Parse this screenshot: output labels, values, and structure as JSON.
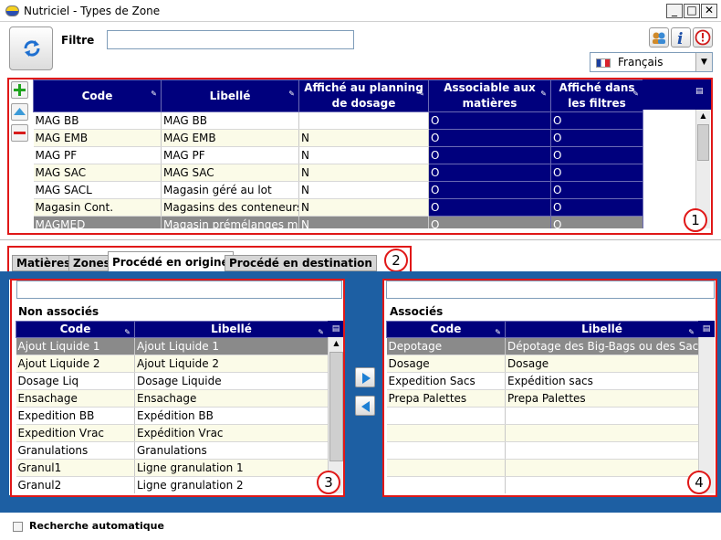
{
  "window": {
    "title": "Nutriciel - Types de Zone",
    "minimize": "_",
    "maximize": "□",
    "close": "✕"
  },
  "filter": {
    "label": "Filtre",
    "value": ""
  },
  "language": {
    "selected": "Français"
  },
  "top_grid": {
    "columns": [
      "Code",
      "Libellé",
      "Affiché au planning de dosage",
      "Associable aux matières",
      "Affiché dans les filtres"
    ],
    "rows": [
      [
        "MAG BB",
        "MAG BB",
        "",
        "O",
        "O"
      ],
      [
        "MAG EMB",
        "MAG EMB",
        "N",
        "O",
        "O"
      ],
      [
        "MAG PF",
        "MAG PF",
        "N",
        "O",
        "O"
      ],
      [
        "MAG SAC",
        "MAG SAC",
        "N",
        "O",
        "O"
      ],
      [
        "MAG SACL",
        "Magasin géré au lot",
        "N",
        "O",
        "O"
      ],
      [
        "Magasin Cont.",
        "Magasins des conteneurs",
        "N",
        "O",
        "O"
      ],
      [
        "MAGMED",
        "Magasin prémélanges mé",
        "N",
        "O",
        "O"
      ]
    ]
  },
  "tabs": [
    {
      "label": "Matières"
    },
    {
      "label": "Zones"
    },
    {
      "label": "Procédé en origine"
    },
    {
      "label": "Procédé en destination"
    }
  ],
  "non_associes": {
    "title": "Non associés",
    "search_value": "",
    "columns": [
      "Code",
      "Libellé"
    ],
    "rows": [
      [
        "Ajout Liquide 1",
        "Ajout Liquide 1"
      ],
      [
        "Ajout Liquide 2",
        "Ajout Liquide 2"
      ],
      [
        "Dosage Liq",
        "Dosage Liquide"
      ],
      [
        "Ensachage",
        "Ensachage"
      ],
      [
        "Expedition BB",
        "Expédition BB"
      ],
      [
        "Expedition Vrac",
        "Expédition Vrac"
      ],
      [
        "Granulations",
        "Granulations"
      ],
      [
        "Granul1",
        "Ligne granulation 1"
      ],
      [
        "Granul2",
        "Ligne granulation 2"
      ]
    ]
  },
  "associes": {
    "title": "Associés",
    "search_value": "",
    "columns": [
      "Code",
      "Libellé"
    ],
    "rows": [
      [
        "Depotage",
        "Dépotage des Big-Bags ou des Sacs"
      ],
      [
        "Dosage",
        "Dosage"
      ],
      [
        "Expedition Sacs",
        "Expédition sacs"
      ],
      [
        "Prepa Palettes",
        "Prepa Palettes"
      ],
      [
        "",
        ""
      ],
      [
        "",
        ""
      ],
      [
        "",
        ""
      ],
      [
        "",
        ""
      ],
      [
        "",
        ""
      ]
    ]
  },
  "callouts": [
    "1",
    "2",
    "3",
    "4"
  ],
  "auto_search": {
    "label": "Recherche automatique",
    "checked": false
  },
  "colors": {
    "header_blue": "#00007d",
    "panel_blue": "#1d5fa3",
    "selected_gray": "#8a8a8a",
    "callout_red": "#e01818"
  }
}
